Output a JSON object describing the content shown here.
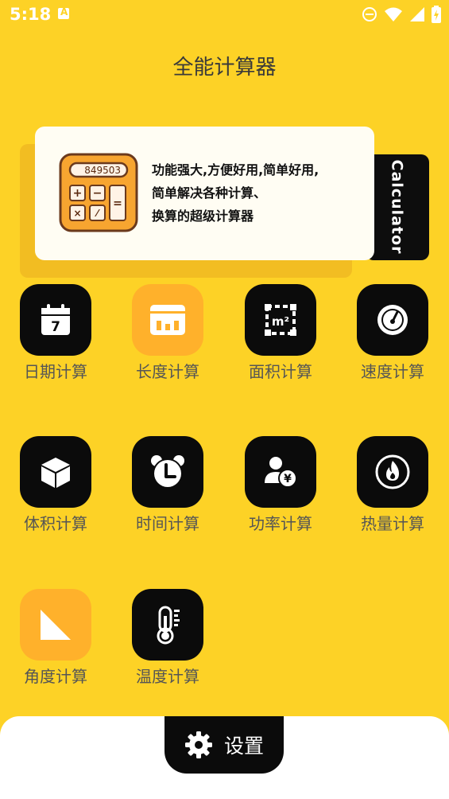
{
  "status_bar": {
    "time": "5:18",
    "notification_letter": "A"
  },
  "app": {
    "title": "全能计算器"
  },
  "banner": {
    "display_number": "849503",
    "line1": "功能强大,方便好用,简单好用,",
    "line2": "简单解决各种计算、",
    "line3": "换算的超级计算器",
    "side_label": "Calculator"
  },
  "grid": {
    "items": [
      {
        "label": "日期计算",
        "icon": "calendar-icon",
        "day": "7"
      },
      {
        "label": "长度计算",
        "icon": "ruler-icon"
      },
      {
        "label": "面积计算",
        "icon": "area-icon",
        "unit": "m²"
      },
      {
        "label": "速度计算",
        "icon": "speedometer-icon"
      },
      {
        "label": "体积计算",
        "icon": "cube-icon"
      },
      {
        "label": "时间计算",
        "icon": "alarm-clock-icon"
      },
      {
        "label": "功率计算",
        "icon": "user-yen-icon",
        "symbol": "¥"
      },
      {
        "label": "热量计算",
        "icon": "flame-icon"
      },
      {
        "label": "角度计算",
        "icon": "triangle-icon"
      },
      {
        "label": "温度计算",
        "icon": "thermometer-icon"
      }
    ]
  },
  "bottom": {
    "settings_label": "设置"
  },
  "colors": {
    "background": "#FDD226",
    "tile_dark": "#0B0B0B",
    "tile_orange": "#FFB12B",
    "card": "#FFFDF3"
  }
}
